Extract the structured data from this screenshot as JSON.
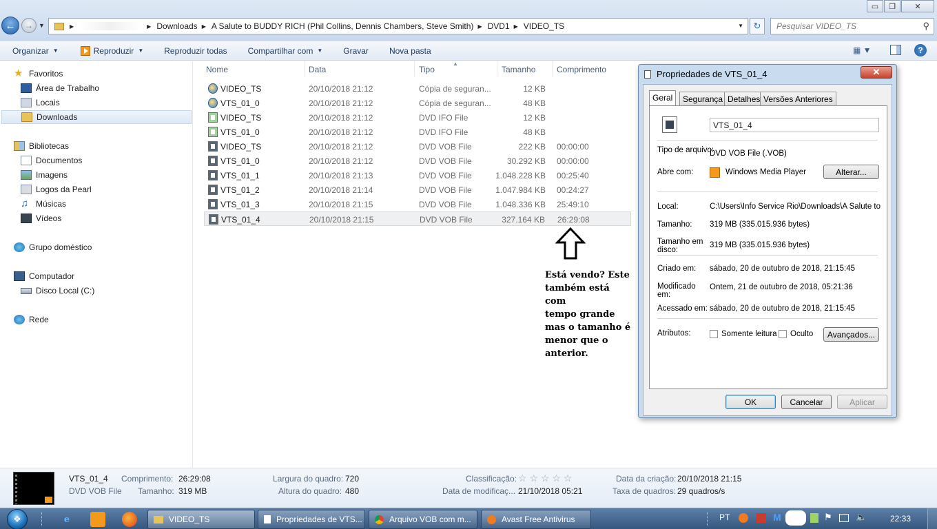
{
  "window": {
    "controls": {
      "minimize": "▭",
      "maximize": "❐",
      "close": "✕"
    }
  },
  "address_bar": {
    "breadcrumb": [
      "Downloads",
      "A Salute to BUDDY RICH (Phil Collins, Dennis Chambers, Steve Smith)",
      "DVD1",
      "VIDEO_TS"
    ],
    "search_placeholder": "Pesquisar VIDEO_TS"
  },
  "toolbar": {
    "organize": "Organizar",
    "play": "Reproduzir",
    "play_all": "Reproduzir todas",
    "share": "Compartilhar com",
    "burn": "Gravar",
    "new_folder": "Nova pasta"
  },
  "nav": {
    "favorites": "Favoritos",
    "desktop": "Área de Trabalho",
    "places": "Locais",
    "downloads": "Downloads",
    "libraries": "Bibliotecas",
    "documents": "Documentos",
    "images": "Imagens",
    "pearl_logos": "Logos da Pearl",
    "music": "Músicas",
    "videos": "Vídeos",
    "homegroup": "Grupo doméstico",
    "computer": "Computador",
    "local_disk": "Disco Local (C:)",
    "network": "Rede"
  },
  "file_list": {
    "columns": {
      "name": "Nome",
      "date": "Data",
      "type": "Tipo",
      "size": "Tamanho",
      "length": "Comprimento"
    },
    "rows": [
      {
        "name": "VIDEO_TS",
        "date": "20/10/2018 21:12",
        "type": "Cópia de seguran...",
        "size": "12 KB",
        "length": "",
        "icon": "backup-icon"
      },
      {
        "name": "VTS_01_0",
        "date": "20/10/2018 21:12",
        "type": "Cópia de seguran...",
        "size": "48 KB",
        "length": "",
        "icon": "backup-icon"
      },
      {
        "name": "VIDEO_TS",
        "date": "20/10/2018 21:12",
        "type": "DVD IFO File",
        "size": "12 KB",
        "length": "",
        "icon": "ifo-icon"
      },
      {
        "name": "VTS_01_0",
        "date": "20/10/2018 21:12",
        "type": "DVD IFO File",
        "size": "48 KB",
        "length": "",
        "icon": "ifo-icon"
      },
      {
        "name": "VIDEO_TS",
        "date": "20/10/2018 21:12",
        "type": "DVD VOB File",
        "size": "222 KB",
        "length": "00:00:00",
        "icon": "vob-icon"
      },
      {
        "name": "VTS_01_0",
        "date": "20/10/2018 21:12",
        "type": "DVD VOB File",
        "size": "30.292 KB",
        "length": "00:00:00",
        "icon": "vob-icon"
      },
      {
        "name": "VTS_01_1",
        "date": "20/10/2018 21:13",
        "type": "DVD VOB File",
        "size": "1.048.228 KB",
        "length": "00:25:40",
        "icon": "vob-icon"
      },
      {
        "name": "VTS_01_2",
        "date": "20/10/2018 21:14",
        "type": "DVD VOB File",
        "size": "1.047.984 KB",
        "length": "00:24:27",
        "icon": "vob-icon"
      },
      {
        "name": "VTS_01_3",
        "date": "20/10/2018 21:15",
        "type": "DVD VOB File",
        "size": "1.048.336 KB",
        "length": "25:49:10",
        "icon": "vob-icon"
      },
      {
        "name": "VTS_01_4",
        "date": "20/10/2018 21:15",
        "type": "DVD VOB File",
        "size": "327.164 KB",
        "length": "26:29:08",
        "icon": "vob-icon"
      }
    ]
  },
  "annotation": {
    "lines": [
      "Está vendo? Este",
      "também está com",
      "tempo grande",
      "mas o tamanho é",
      "menor que o",
      "anterior."
    ]
  },
  "dialog": {
    "title": "Propriedades de VTS_01_4",
    "close": "✕",
    "tabs": [
      "Geral",
      "Segurança",
      "Detalhes",
      "Versões Anteriores"
    ],
    "file_name": "VTS_01_4",
    "type_label": "Tipo de arquivo:",
    "type_value": "DVD VOB File (.VOB)",
    "opens_label": "Abre com:",
    "opens_value": "Windows Media Player",
    "change_btn": "Alterar...",
    "location_label": "Local:",
    "location_value": "C:\\Users\\Info Service Rio\\Downloads\\A Salute to B",
    "size_label": "Tamanho:",
    "size_value": "319 MB (335.015.936 bytes)",
    "disk_label": "Tamanho em disco:",
    "disk_value": "319 MB (335.015.936 bytes)",
    "created_label": "Criado em:",
    "created_value": "sábado, 20 de outubro de 2018, 21:15:45",
    "modified_label": "Modificado em:",
    "modified_value": "Ontem, 21 de outubro de 2018, 05:21:36",
    "accessed_label": "Acessado em:",
    "accessed_value": "sábado, 20 de outubro de 2018, 21:15:45",
    "attrs_label": "Atributos:",
    "readonly": "Somente leitura",
    "hidden": "Oculto",
    "advanced_btn": "Avançados...",
    "ok": "OK",
    "cancel": "Cancelar",
    "apply": "Aplicar"
  },
  "details_pane": {
    "name": "VTS_01_4",
    "type": "DVD VOB File",
    "length_label": "Comprimento:",
    "length_value": "26:29:08",
    "size_label": "Tamanho:",
    "size_value": "319 MB",
    "width_label": "Largura do quadro:",
    "width_value": "720",
    "height_label": "Altura do quadro:",
    "height_value": "480",
    "rating_label": "Classificação:",
    "rating_stars": "☆ ☆ ☆ ☆ ☆",
    "modified_label": "Data de modificaç...",
    "modified_value": "21/10/2018 05:21",
    "created_label": "Data da criação:",
    "created_value": "20/10/2018 21:15",
    "fps_label": "Taxa de quadros:",
    "fps_value": "29 quadros/s"
  },
  "taskbar": {
    "tasks": [
      "VIDEO_TS",
      "Propriedades de VTS...",
      "Arquivo VOB com m...",
      "Avast Free Antivirus"
    ],
    "lang": "PT",
    "clock": "22:33"
  }
}
